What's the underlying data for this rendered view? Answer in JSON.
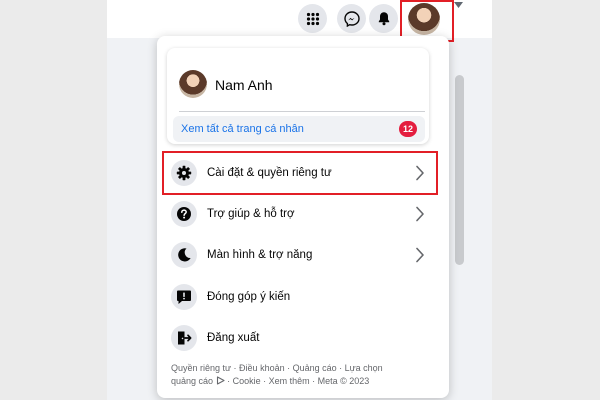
{
  "colors": {
    "highlight": "#e21f26",
    "link": "#1a73e8",
    "badge": "#e41e3f"
  },
  "topbar": {
    "icons": [
      "menu-grid-icon",
      "messenger-icon",
      "bell-icon",
      "profile-avatar"
    ]
  },
  "profile": {
    "name": "Nam Anh",
    "see_all": "Xem tất cả trang cá nhân",
    "badge_count": "12"
  },
  "menu": {
    "items": [
      {
        "label": "Cài đặt & quyền riêng tư",
        "icon": "gear-icon",
        "has_chevron": true,
        "highlighted": true
      },
      {
        "label": "Trợ giúp & hỗ trợ",
        "icon": "help-icon",
        "has_chevron": true
      },
      {
        "label": "Màn hình & trợ năng",
        "icon": "moon-icon",
        "has_chevron": true
      },
      {
        "label": "Đóng góp ý kiến",
        "icon": "feedback-icon",
        "has_chevron": false
      },
      {
        "label": "Đăng xuất",
        "icon": "logout-icon",
        "has_chevron": false
      }
    ]
  },
  "footer": {
    "line1": "Quyền riêng tư · Điều khoản · Quảng cáo · Lựa chọn",
    "line2a": "quảng cáo",
    "line2b": "· Cookie · Xem thêm · Meta © 2023"
  }
}
